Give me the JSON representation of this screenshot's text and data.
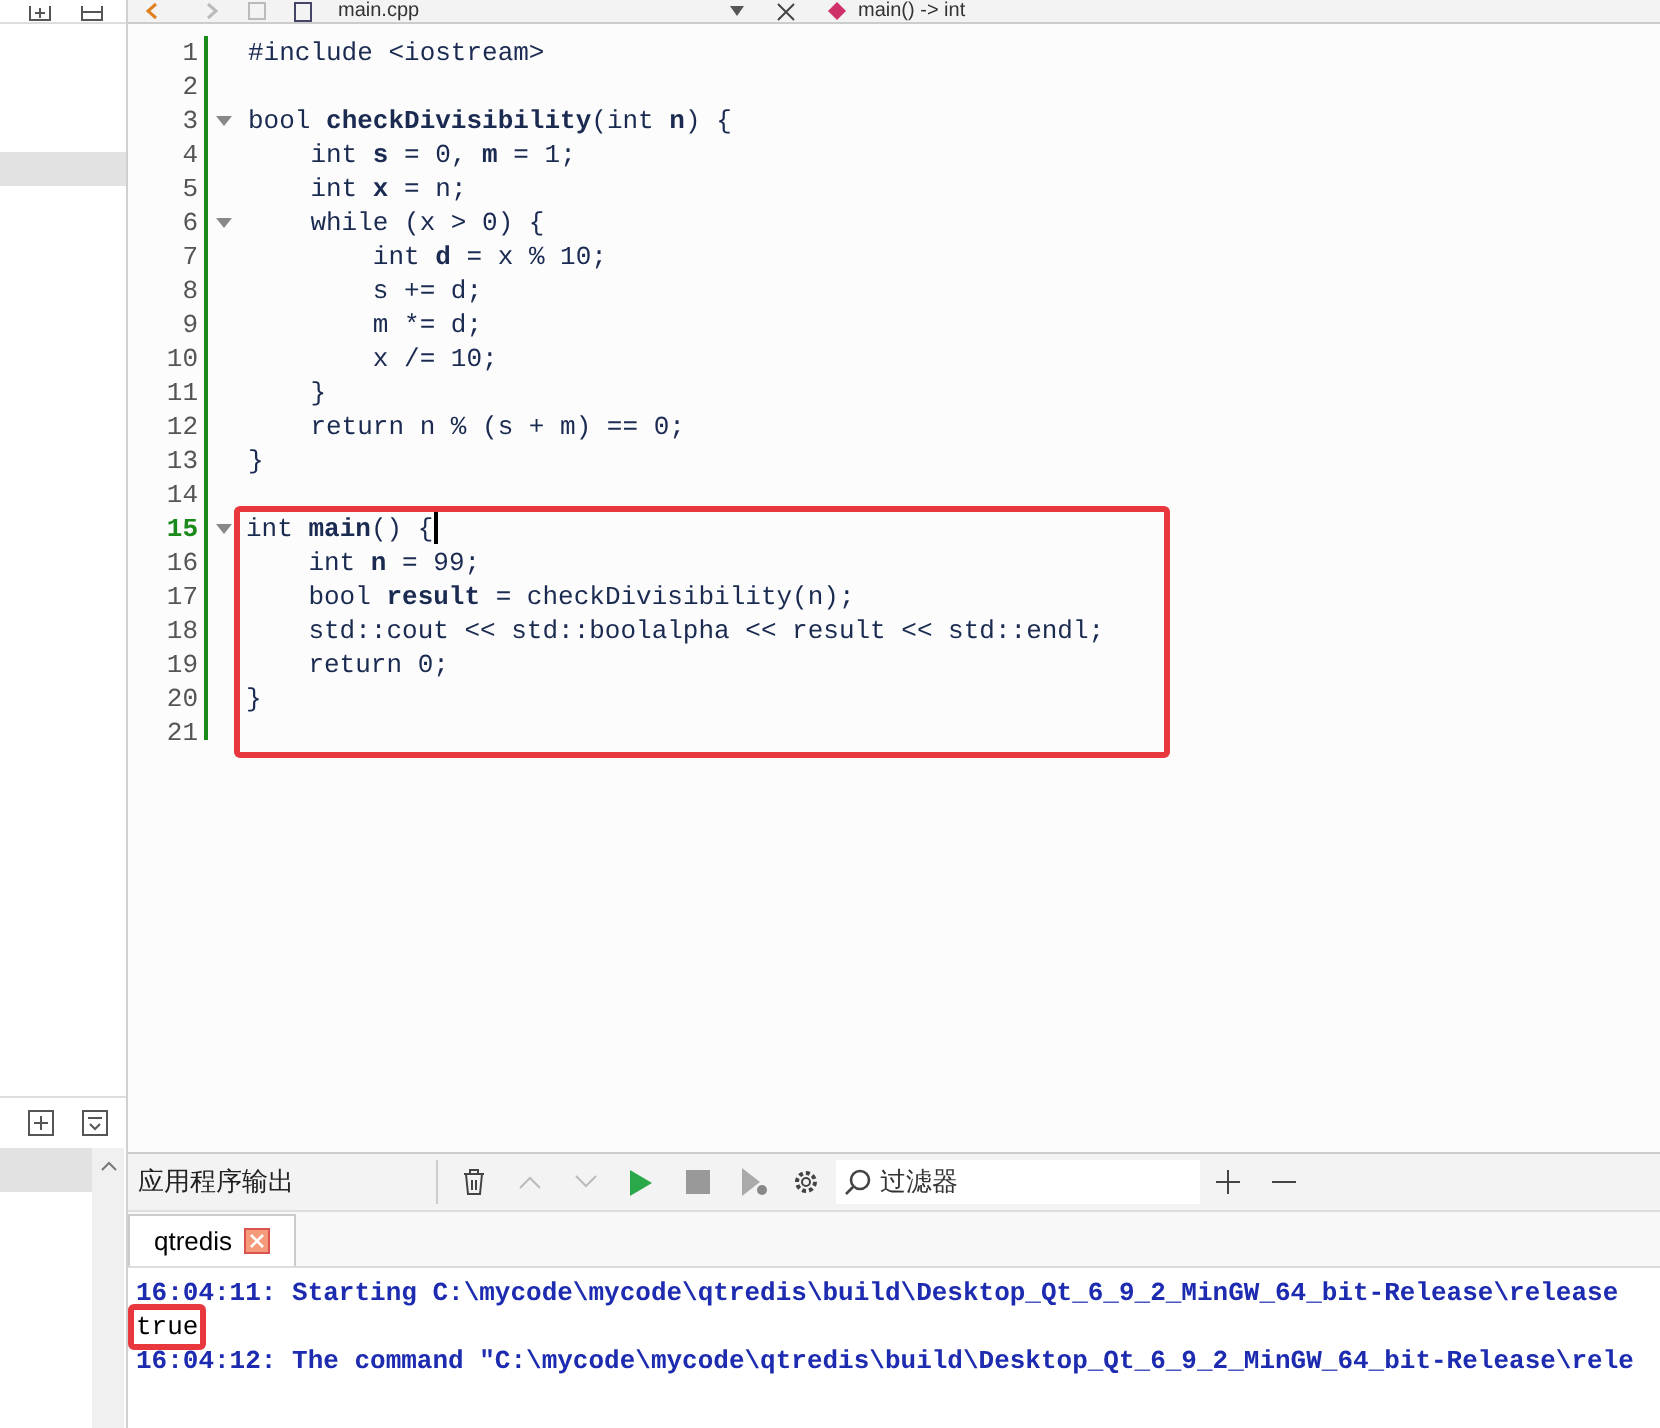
{
  "editor_toolbar": {
    "file_name": "main.cpp",
    "symbol": "main() -> int"
  },
  "code_lines": [
    {
      "number": "1",
      "text": "#include <iostream>"
    },
    {
      "number": "2"
    },
    {
      "number": "3",
      "foldable": true,
      "text": "bool **checkDivisibility**(int **n**) {"
    },
    {
      "number": "4",
      "text": "    int **s** = 0, **m** = 1;"
    },
    {
      "number": "5",
      "text": "    int **x** = n;"
    },
    {
      "number": "6",
      "foldable": true,
      "text": "    while (x > 0) {"
    },
    {
      "number": "7",
      "text": "        int **d** = x % 10;"
    },
    {
      "number": "8",
      "text": "        s += d;"
    },
    {
      "number": "9",
      "text": "        m *= d;"
    },
    {
      "number": "10",
      "text": "        x /= 10;"
    },
    {
      "number": "11",
      "text": "    }"
    },
    {
      "number": "12",
      "text": "    return n % (s + m) == 0;"
    },
    {
      "number": "13",
      "text": "}"
    },
    {
      "number": "14"
    }
  ],
  "highlighted_lines": [
    {
      "number": "15",
      "foldable": true,
      "current": true,
      "text": "int **main**() {"
    },
    {
      "number": "16",
      "text": "    int **n** = 99;"
    },
    {
      "number": "17",
      "text": "    bool **result** = checkDivisibility(n);"
    },
    {
      "number": "18",
      "text": "    std::cout << std::boolalpha << result << std::endl;"
    },
    {
      "number": "19",
      "text": "    return 0;"
    },
    {
      "number": "20",
      "text": "}"
    },
    {
      "number": "21"
    }
  ],
  "output_panel": {
    "title": "应用程序输出",
    "filter_placeholder": "过滤器",
    "tabs": [
      {
        "label": "qtredis",
        "selected": true
      }
    ],
    "lines": [
      {
        "kind": "info",
        "text": "16:04:11: Starting C:\\mycode\\mycode\\qtredis\\build\\Desktop_Qt_6_9_2_MinGW_64_bit-Release\\release"
      },
      {
        "kind": "highlighted",
        "text": "true"
      },
      {
        "kind": "info",
        "text": "16:04:12: The command \"C:\\mycode\\mycode\\qtredis\\build\\Desktop_Qt_6_9_2_MinGW_64_bit-Release\\rele"
      }
    ]
  }
}
